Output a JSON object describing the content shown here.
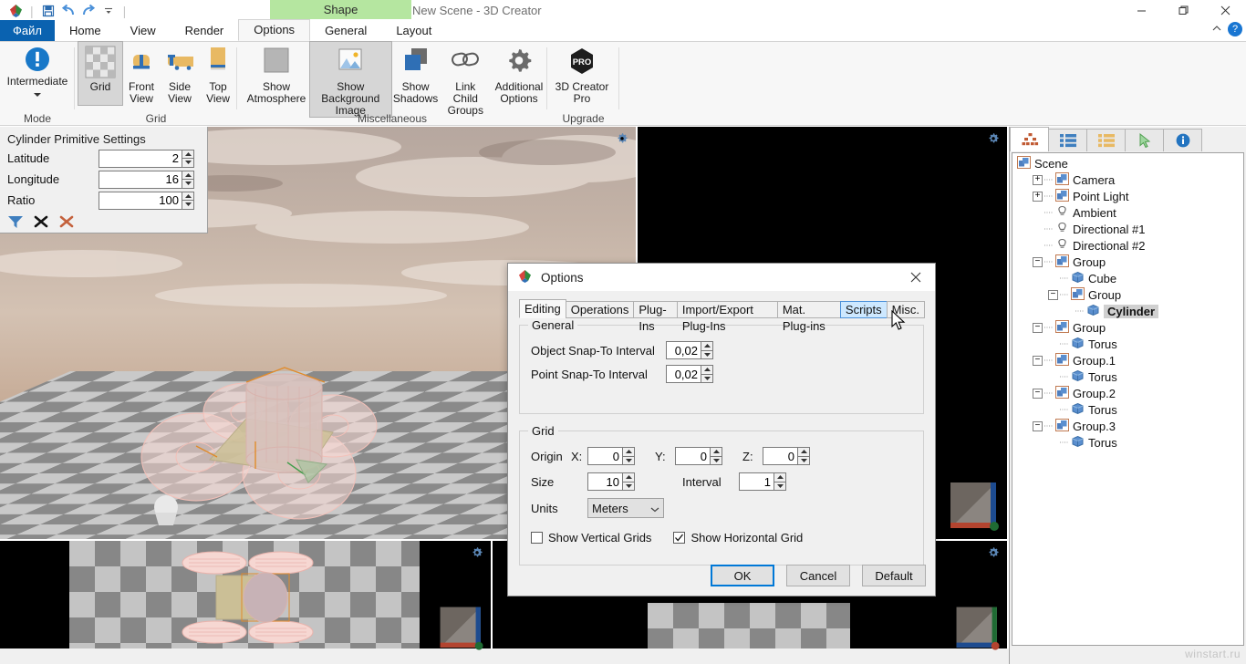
{
  "window": {
    "title": "New Scene - 3D Creator",
    "shape_tab": "Shape",
    "watermark": "winstart.ru",
    "controls": {
      "minimize": "minimize-icon",
      "maximize": "maximize-icon",
      "close": "close-icon"
    }
  },
  "quick_access": {
    "app_logo": "app-logo-icon",
    "items": [
      {
        "name": "save-icon",
        "label": "Save"
      },
      {
        "name": "undo-icon",
        "label": "Undo"
      },
      {
        "name": "redo-icon",
        "label": "Redo"
      },
      {
        "name": "customize-qat-icon",
        "label": "Customize Quick Access Toolbar"
      }
    ]
  },
  "ribbon": {
    "tabs": [
      {
        "label": "Файл",
        "kind": "file"
      },
      {
        "label": "Home",
        "kind": "normal"
      },
      {
        "label": "View",
        "kind": "normal"
      },
      {
        "label": "Render",
        "kind": "normal"
      },
      {
        "label": "Options",
        "kind": "active"
      },
      {
        "label": "General",
        "kind": "normal"
      },
      {
        "label": "Layout",
        "kind": "normal"
      }
    ],
    "collapse_label": "collapse-ribbon-icon",
    "help_label": "?",
    "groups": [
      {
        "name": "mode",
        "label": "Mode",
        "items": [
          {
            "name": "intermediate-mode",
            "caption": "Intermediate",
            "icon": "exclamation-circle-icon",
            "state": "dropdown"
          }
        ]
      },
      {
        "name": "grid",
        "label": "Grid",
        "items": [
          {
            "name": "grid-toggle",
            "caption": "Grid",
            "icon": "checkerboard-icon",
            "state": "toggled"
          },
          {
            "name": "front-view",
            "caption": "Front\nView",
            "icon": "front-view-icon",
            "state": "normal"
          },
          {
            "name": "side-view",
            "caption": "Side\nView",
            "icon": "side-view-icon",
            "state": "normal"
          },
          {
            "name": "top-view",
            "caption": "Top\nView",
            "icon": "top-view-icon",
            "state": "normal"
          }
        ]
      },
      {
        "name": "miscellaneous",
        "label": "Miscellaneous",
        "items": [
          {
            "name": "show-atmosphere",
            "caption": "Show\nAtmosphere",
            "icon": "atmosphere-icon",
            "state": "normal"
          },
          {
            "name": "show-background-image",
            "caption": "Show Background\nImage",
            "icon": "picture-icon",
            "state": "toggled"
          },
          {
            "name": "show-shadows",
            "caption": "Show\nShadows",
            "icon": "shadows-icon",
            "state": "normal"
          },
          {
            "name": "link-child-groups",
            "caption": "Link Child\nGroups",
            "icon": "chain-link-icon",
            "state": "normal"
          },
          {
            "name": "additional-options",
            "caption": "Additional\nOptions",
            "icon": "gear-icon",
            "state": "normal"
          }
        ]
      },
      {
        "name": "upgrade",
        "label": "Upgrade",
        "items": [
          {
            "name": "3d-creator-pro",
            "caption": "3D Creator\nPro",
            "icon": "pro-badge-icon",
            "state": "normal"
          }
        ]
      }
    ]
  },
  "primitive_panel": {
    "title": "Cylinder Primitive Settings",
    "fields": [
      {
        "label": "Latitude",
        "value": "2"
      },
      {
        "label": "Longitude",
        "value": "16"
      },
      {
        "label": "Ratio",
        "value": "100"
      }
    ],
    "actions": [
      {
        "name": "apply-filter-icon",
        "glyph": "▼"
      },
      {
        "name": "close-black-icon",
        "glyph": "✕"
      },
      {
        "name": "close-red-icon",
        "glyph": "✕"
      }
    ]
  },
  "viewports": [
    {
      "name": "perspective-viewport",
      "gear": "viewport-settings-icon",
      "axis": "axis-gizmo"
    },
    {
      "name": "front-viewport",
      "gear": "viewport-settings-icon",
      "axis": "axis-gizmo"
    },
    {
      "name": "top-viewport",
      "gear": "viewport-settings-icon",
      "axis": "axis-gizmo"
    },
    {
      "name": "side-viewport",
      "gear": "viewport-settings-icon",
      "axis": "axis-gizmo"
    }
  ],
  "scene_panel": {
    "tabs": [
      {
        "name": "hierarchy-tab",
        "icon": "hierarchy-icon",
        "active": true
      },
      {
        "name": "objects-list-tab",
        "icon": "blue-list-icon",
        "active": false
      },
      {
        "name": "materials-list-tab",
        "icon": "orange-list-icon",
        "active": false
      },
      {
        "name": "selection-tab",
        "icon": "cursor-arrow-icon",
        "active": false
      },
      {
        "name": "info-tab",
        "icon": "info-icon",
        "active": false
      }
    ],
    "tree": [
      {
        "label": "Scene",
        "depth": 0,
        "icon": "group-icon",
        "expander": "none",
        "selected": false
      },
      {
        "label": "Camera",
        "depth": 1,
        "icon": "group-icon",
        "expander": "plus",
        "selected": false
      },
      {
        "label": "Point Light",
        "depth": 1,
        "icon": "group-icon",
        "expander": "plus",
        "selected": false
      },
      {
        "label": "Ambient",
        "depth": 1,
        "icon": "light-icon",
        "expander": "none",
        "selected": false
      },
      {
        "label": "Directional #1",
        "depth": 1,
        "icon": "light-icon",
        "expander": "none",
        "selected": false
      },
      {
        "label": "Directional #2",
        "depth": 1,
        "icon": "light-icon",
        "expander": "none",
        "selected": false
      },
      {
        "label": "Group",
        "depth": 1,
        "icon": "group-icon",
        "expander": "minus",
        "selected": false
      },
      {
        "label": "Cube",
        "depth": 2,
        "icon": "object-icon",
        "expander": "none",
        "selected": false
      },
      {
        "label": "Group",
        "depth": 2,
        "icon": "group-icon",
        "expander": "minus",
        "selected": false
      },
      {
        "label": "Cylinder",
        "depth": 3,
        "icon": "object-icon",
        "expander": "none",
        "selected": true
      },
      {
        "label": "Group",
        "depth": 1,
        "icon": "group-icon",
        "expander": "minus",
        "selected": false
      },
      {
        "label": "Torus",
        "depth": 2,
        "icon": "object-icon",
        "expander": "none",
        "selected": false
      },
      {
        "label": "Group.1",
        "depth": 1,
        "icon": "group-icon",
        "expander": "minus",
        "selected": false
      },
      {
        "label": "Torus",
        "depth": 2,
        "icon": "object-icon",
        "expander": "none",
        "selected": false
      },
      {
        "label": "Group.2",
        "depth": 1,
        "icon": "group-icon",
        "expander": "minus",
        "selected": false
      },
      {
        "label": "Torus",
        "depth": 2,
        "icon": "object-icon",
        "expander": "none",
        "selected": false
      },
      {
        "label": "Group.3",
        "depth": 1,
        "icon": "group-icon",
        "expander": "minus",
        "selected": false
      },
      {
        "label": "Torus",
        "depth": 2,
        "icon": "object-icon",
        "expander": "none",
        "selected": false
      }
    ]
  },
  "dialog": {
    "title": "Options",
    "icon": "app-logo-icon",
    "close_icon": "close-icon",
    "tabs": [
      {
        "label": "Editing",
        "state": "active"
      },
      {
        "label": "Operations",
        "state": "normal"
      },
      {
        "label": "Plug-Ins",
        "state": "normal"
      },
      {
        "label": "Import/Export Plug-Ins",
        "state": "normal"
      },
      {
        "label": "Mat. Plug-ins",
        "state": "normal"
      },
      {
        "label": "Scripts",
        "state": "hover"
      },
      {
        "label": "Misc.",
        "state": "normal"
      }
    ],
    "general": {
      "legend": "General",
      "fields": [
        {
          "label": "Object Snap-To Interval",
          "value": "0,02"
        },
        {
          "label": "Point Snap-To Interval",
          "value": "0,02"
        }
      ]
    },
    "grid": {
      "legend": "Grid",
      "origin_label": "Origin",
      "origin": [
        {
          "label": "X:",
          "value": "0"
        },
        {
          "label": "Y:",
          "value": "0"
        },
        {
          "label": "Z:",
          "value": "0"
        }
      ],
      "size": {
        "label": "Size",
        "value": "10"
      },
      "interval": {
        "label": "Interval",
        "value": "1"
      },
      "units": {
        "label": "Units",
        "value": "Meters"
      },
      "checkboxes": [
        {
          "label": "Show Vertical Grids",
          "checked": false
        },
        {
          "label": "Show Horizontal Grid",
          "checked": true
        }
      ]
    },
    "buttons": [
      {
        "label": "OK",
        "style": "default"
      },
      {
        "label": "Cancel",
        "style": "normal"
      },
      {
        "label": "Default",
        "style": "normal"
      }
    ]
  }
}
